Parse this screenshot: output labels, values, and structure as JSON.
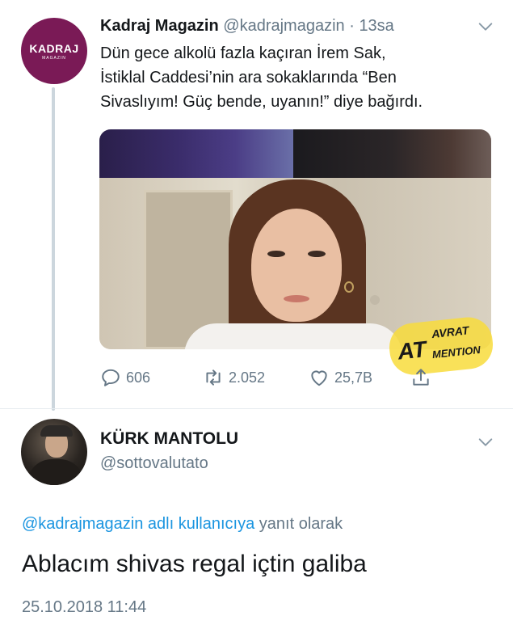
{
  "tweet": {
    "avatar": {
      "logo_main": "KADRAJ",
      "logo_sub": "MAGAZIN",
      "color": "#7a1a56"
    },
    "display_name": "Kadraj Magazin",
    "handle": "@kadrajmagazin",
    "separator": "·",
    "time_ago": "13sa",
    "text": "Dün gece alkolü fazla kaçıran İrem Sak,\nİstiklal Caddesi’nin ara sokaklarında “Ben\nSivaslıyım! Güç bende, uyanın!” diye bağırdı.",
    "watermark": {
      "part1": "AT",
      "part2": "AVRAT",
      "part3": "MENTION"
    },
    "counts": {
      "replies": "606",
      "retweets": "2.052",
      "likes": "25,7B"
    },
    "icons": {
      "menu": "chevron-down-icon",
      "reply": "reply-icon",
      "retweet": "retweet-icon",
      "like": "heart-icon",
      "share": "share-icon"
    }
  },
  "reply": {
    "display_name": "KÜRK MANTOLU",
    "handle": "@sottovalutato",
    "reply_context": {
      "mention": "@kadrajmagazin adlı kullanıcıya",
      "suffix": " yanıt olarak"
    },
    "text": "Ablacım shivas regal içtin galiba",
    "timestamp": "25.10.2018 11:44"
  },
  "colors": {
    "link": "#1b95e0",
    "muted": "#657786",
    "text": "#14171a"
  }
}
